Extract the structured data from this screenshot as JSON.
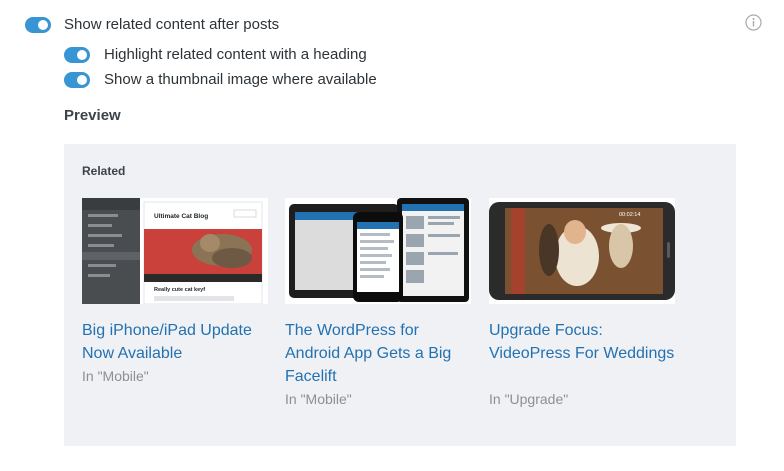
{
  "settings": {
    "main_toggle": {
      "label": "Show related content after posts",
      "on": true
    },
    "sub_toggles": [
      {
        "label": "Highlight related content with a heading",
        "on": true
      },
      {
        "label": "Show a thumbnail image where available",
        "on": true
      }
    ]
  },
  "preview": {
    "heading": "Preview",
    "related_heading": "Related",
    "posts": [
      {
        "title": "Big iPhone/iPad Update Now Available",
        "category": "In \"Mobile\"",
        "thumb_title": "Ultimate Cat Blog",
        "thumb_caption": "Really cute cat keyf"
      },
      {
        "title": "The WordPress for Android App Gets a Big Facelift",
        "category": "In \"Mobile\""
      },
      {
        "title": "Upgrade Focus: VideoPress For Weddings",
        "category": "In \"Upgrade\"",
        "thumb_time": "00:02:14"
      }
    ]
  },
  "colors": {
    "accent": "#3895d3",
    "link": "#2271b1",
    "muted": "#8c8f94",
    "panel": "#f0f1f4"
  },
  "icons": {
    "info": "info-icon"
  }
}
